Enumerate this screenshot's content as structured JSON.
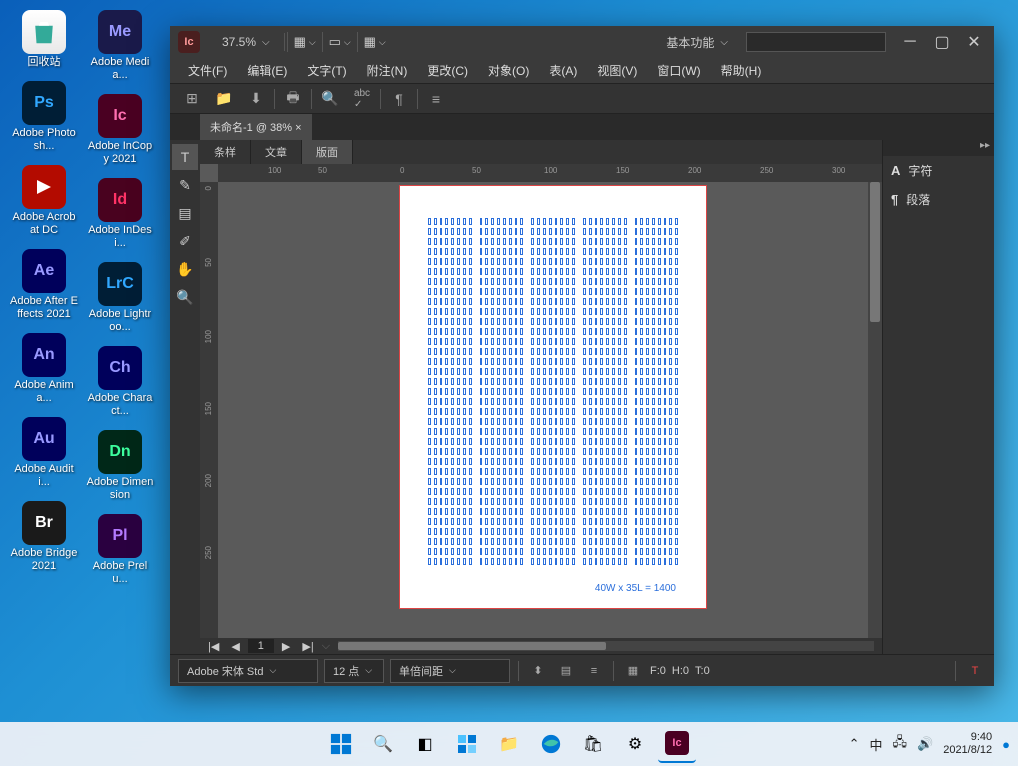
{
  "desktop": {
    "icons": [
      {
        "label": "回收站",
        "bg": "recycle",
        "short": ""
      },
      {
        "label": "Adobe Media...",
        "bg": "#1a1a4a",
        "short": "Me",
        "fg": "#9a9aff"
      },
      {
        "label": "Adobe Photosh...",
        "bg": "#001e36",
        "short": "Ps",
        "fg": "#31a8ff"
      },
      {
        "label": "Adobe InCopy 2021",
        "bg": "#4a0022",
        "short": "Ic",
        "fg": "#ff6eb0"
      },
      {
        "label": "Adobe Acrobat DC",
        "bg": "#b30b00",
        "short": "",
        "fg": "#fff"
      },
      {
        "label": "Adobe InDesi...",
        "bg": "#49021f",
        "short": "Id",
        "fg": "#ff3366"
      },
      {
        "label": "Adobe After Effects 2021",
        "bg": "#00005b",
        "short": "Ae",
        "fg": "#9999ff"
      },
      {
        "label": "Adobe Lightroo...",
        "bg": "#001e36",
        "short": "LrC",
        "fg": "#31a8ff"
      },
      {
        "label": "Adobe Anima...",
        "bg": "#00005b",
        "short": "An",
        "fg": "#9999ff"
      },
      {
        "label": "Adobe Charact...",
        "bg": "#00005b",
        "short": "Ch",
        "fg": "#9999ff"
      },
      {
        "label": "Adobe Auditi...",
        "bg": "#00005b",
        "short": "Au",
        "fg": "#9999ff"
      },
      {
        "label": "Adobe Dimension",
        "bg": "#002818",
        "short": "Dn",
        "fg": "#3cff9e"
      },
      {
        "label": "Adobe Bridge 2021",
        "bg": "#1a1a1a",
        "short": "Br",
        "fg": "#fff"
      },
      {
        "label": "Adobe Prelu...",
        "bg": "#2a0040",
        "short": "Pl",
        "fg": "#b47aff"
      }
    ]
  },
  "app": {
    "icon": "Ic",
    "zoom": "37.5%",
    "workspace": "基本功能",
    "menu": [
      "文件(F)",
      "编辑(E)",
      "文字(T)",
      "附注(N)",
      "更改(C)",
      "对象(O)",
      "表(A)",
      "视图(V)",
      "窗口(W)",
      "帮助(H)"
    ],
    "tab": "未命名-1 @ 38% ×",
    "subtabs": [
      "条样",
      "文章",
      "版面"
    ],
    "subtab_selected": 2,
    "hruler": [
      {
        "v": "100",
        "p": 50
      },
      {
        "v": "50",
        "p": 100
      },
      {
        "v": "0",
        "p": 182
      },
      {
        "v": "50",
        "p": 254
      },
      {
        "v": "100",
        "p": 326
      },
      {
        "v": "150",
        "p": 398
      },
      {
        "v": "200",
        "p": 470
      },
      {
        "v": "250",
        "p": 542
      },
      {
        "v": "300",
        "p": 614
      }
    ],
    "vruler": [
      {
        "v": "0",
        "p": 4
      },
      {
        "v": "50",
        "p": 76
      },
      {
        "v": "100",
        "p": 148
      },
      {
        "v": "150",
        "p": 220
      },
      {
        "v": "200",
        "p": 292
      },
      {
        "v": "250",
        "p": 364
      }
    ],
    "page_footer": "40W x 35L = 1400",
    "page_nav": {
      "current": "1"
    },
    "rpanel": [
      {
        "icon": "A",
        "label": "字符"
      },
      {
        "icon": "¶",
        "label": "段落"
      }
    ],
    "status": {
      "font": "Adobe 宋体 Std",
      "size": "12 点",
      "spacing": "单倍间距",
      "f": "F:0",
      "h": "H:0",
      "t": "T:0"
    }
  },
  "tray": {
    "ime": "中",
    "time": "9:40",
    "date": "2021/8/12"
  }
}
